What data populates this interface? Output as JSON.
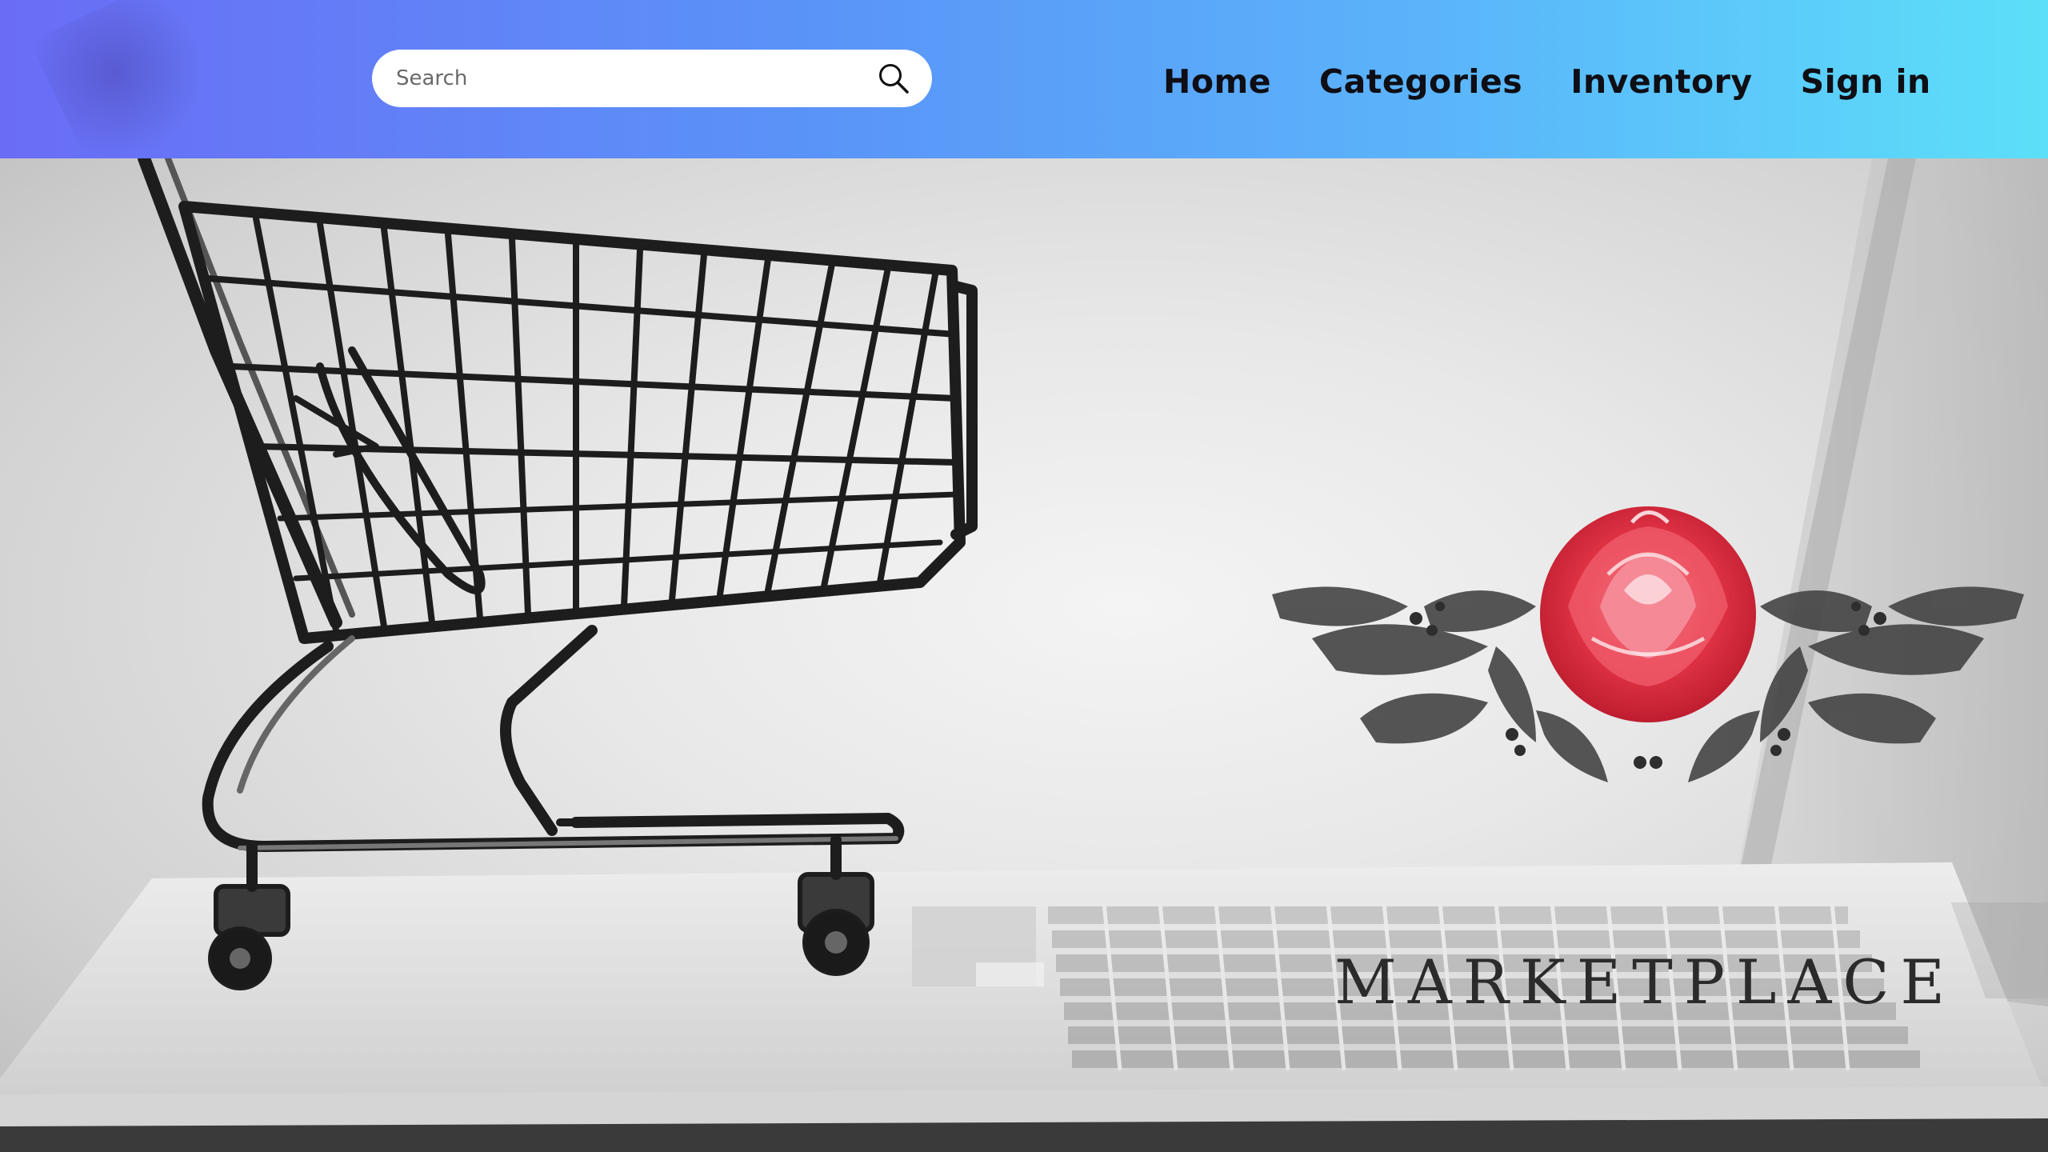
{
  "header": {
    "search": {
      "placeholder": "Search",
      "icon": "search-icon"
    },
    "nav": [
      {
        "label": "Home"
      },
      {
        "label": "Categories"
      },
      {
        "label": "Inventory"
      },
      {
        "label": "Sign in"
      }
    ],
    "gradient": {
      "start": "#6a6cf6",
      "end": "#5cdff9"
    }
  },
  "hero": {
    "logo": {
      "wordmark": "MARKETPLACE",
      "emblem": "red-rose-with-grey-leaves",
      "accent_color": "#e8374a"
    },
    "image": "shopping-cart-on-laptop"
  }
}
